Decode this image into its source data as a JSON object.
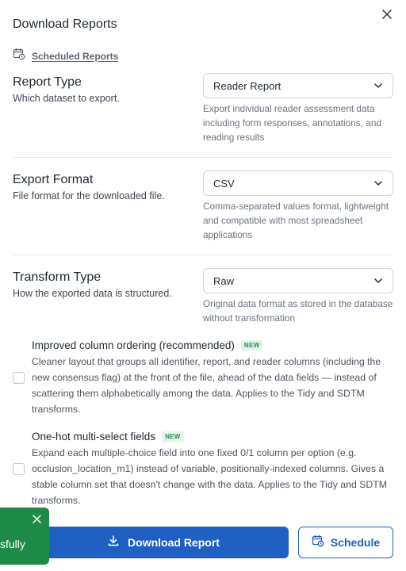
{
  "dialog": {
    "title": "Download Reports",
    "scheduled_link": "Scheduled Reports"
  },
  "report_type": {
    "title": "Report Type",
    "subtitle": "Which dataset to export.",
    "selected": "Reader Report",
    "description": "Export individual reader assessment data including form responses, annotations, and reading results"
  },
  "export_format": {
    "title": "Export Format",
    "subtitle": "File format for the downloaded file.",
    "selected": "CSV",
    "description": "Comma-separated values format, lightweight and compatible with most spreadsheet applications"
  },
  "transform_type": {
    "title": "Transform Type",
    "subtitle": "How the exported data is structured.",
    "selected": "Raw",
    "description": "Original data format as stored in the database without transformation"
  },
  "options": [
    {
      "label": "Improved column ordering (recommended)",
      "badge": "NEW",
      "checked": false,
      "description": "Cleaner layout that groups all identifier, report, and reader columns (including the new consensus flag) at the front of the file, ahead of the data fields — instead of scattering them alphabetically among the data. Applies to the Tidy and SDTM transforms."
    },
    {
      "label": "One-hot multi-select fields",
      "badge": "NEW",
      "checked": false,
      "description": "Expand each multiple-choice field into one fixed 0/1 column per option (e.g. occlusion_location_m1) instead of variable, positionally-indexed columns. Gives a stable column set that doesn't change with the data. Applies to the Tidy and SDTM transforms."
    }
  ],
  "footer": {
    "download_label": "Download Report",
    "schedule_label": "Schedule"
  },
  "toast": {
    "text": "sfully"
  },
  "colors": {
    "primary": "#1f5fc2",
    "toast_bg": "#1e8a47",
    "badge_text": "#2f8a4f",
    "badge_bg": "#e3f4e8"
  }
}
